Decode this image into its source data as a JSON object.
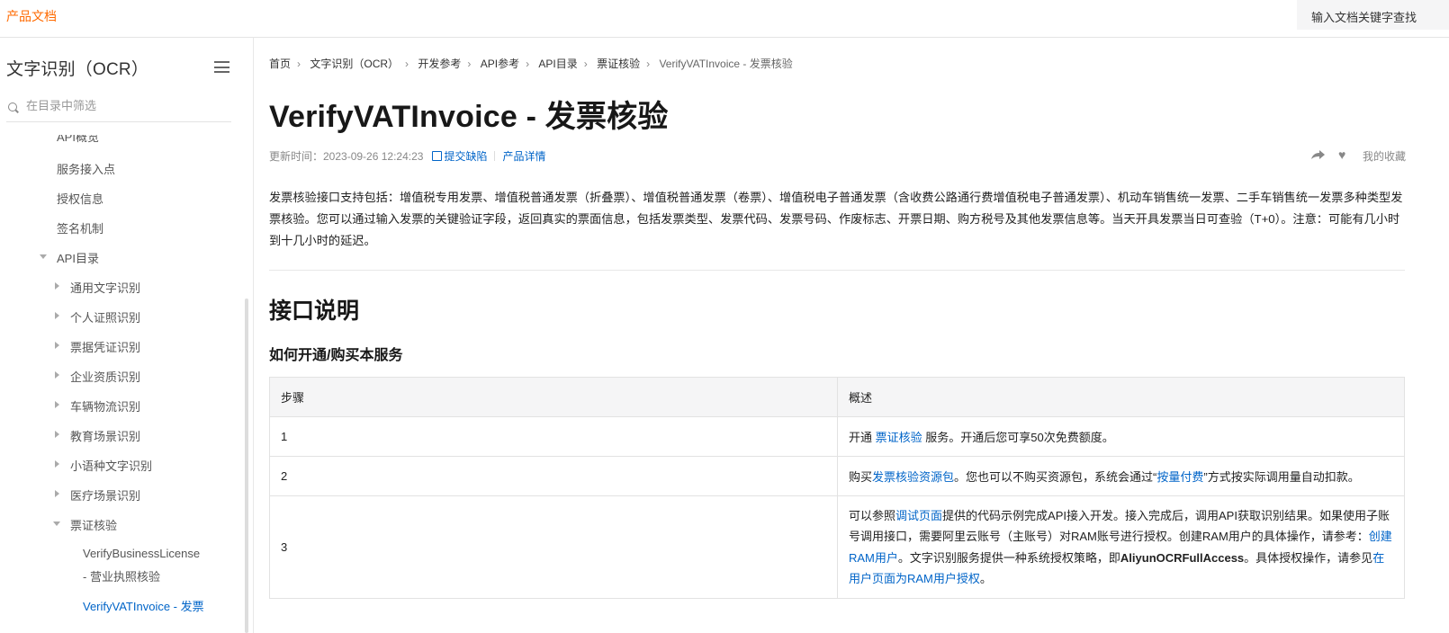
{
  "header": {
    "brand": "产品文档",
    "search_placeholder": "输入文档关键字查找"
  },
  "sidebar": {
    "title": "文字识别（OCR）",
    "filter_placeholder": "在目录中筛选",
    "items": [
      {
        "label": "API概览"
      },
      {
        "label": "服务接入点"
      },
      {
        "label": "授权信息"
      },
      {
        "label": "签名机制"
      },
      {
        "label": "API目录"
      },
      {
        "label": "通用文字识别"
      },
      {
        "label": "个人证照识别"
      },
      {
        "label": "票据凭证识别"
      },
      {
        "label": "企业资质识别"
      },
      {
        "label": "车辆物流识别"
      },
      {
        "label": "教育场景识别"
      },
      {
        "label": "小语种文字识别"
      },
      {
        "label": "医疗场景识别"
      },
      {
        "label": "票证核验"
      },
      {
        "label": "VerifyBusinessLicense"
      },
      {
        "label": "- 营业执照核验"
      },
      {
        "label": "VerifyVATInvoice - 发票"
      }
    ]
  },
  "breadcrumb": [
    "首页",
    "文字识别（OCR）",
    "开发参考",
    "API参考",
    "API目录",
    "票证核验",
    "VerifyVATInvoice - 发票核验"
  ],
  "page": {
    "title": "VerifyVATInvoice - 发票核验",
    "updated": "更新时间：2023-09-26 12:24:23",
    "feedback": "提交缺陷",
    "product_detail": "产品详情",
    "favorite": "我的收藏",
    "intro": "发票核验接口支持包括：增值税专用发票、增值税普通发票（折叠票）、增值税普通发票（卷票）、增值税电子普通发票（含收费公路通行费增值税电子普通发票）、机动车销售统一发票、二手车销售统一发票多种类型发票核验。您可以通过输入发票的关键验证字段，返回真实的票面信息，包括发票类型、发票代码、发票号码、作废标志、开票日期、购方税号及其他发票信息等。当天开具发票当日可查验（T+0）。注意：可能有几小时到十几小时的延迟。",
    "section_title": "接口说明",
    "sub_title": "如何开通/购买本服务"
  },
  "table": {
    "headers": [
      "步骤",
      "概述"
    ],
    "rows": [
      {
        "step": "1",
        "a": "开通 ",
        "link1": "票证核验",
        "b": " 服务。开通后您可享50次免费额度。"
      },
      {
        "step": "2",
        "a": "购买",
        "link1": "发票核验资源包",
        "b": "。您也可以不购买资源包，系统会通过“",
        "link2": "按量付费",
        "c": "”方式按实际调用量自动扣款。"
      },
      {
        "step": "3",
        "a": "可以参照",
        "link1": "调试页面",
        "b": "提供的代码示例完成API接入开发。接入完成后，调用API获取识别结果。如果使用子账号调用接口，需要阿里云账号（主账号）对RAM账号进行授权。创建RAM用户的具体操作，请参考：",
        "link2": "创建RAM用户",
        "c": "。文字识别服务提供一种系统授权策略，即",
        "bold": "AliyunOCRFullAccess",
        "d": "。具体授权操作，请参见",
        "link3": "在用户页面为RAM用户授权",
        "e": "。"
      }
    ]
  },
  "icons": {
    "search": "search-icon",
    "menu": "menu-icon",
    "edit": "edit-icon",
    "share": "share-icon",
    "favorite": "heart-icon"
  },
  "colors": {
    "brand": "#ff6a00",
    "link": "#0064c8"
  }
}
